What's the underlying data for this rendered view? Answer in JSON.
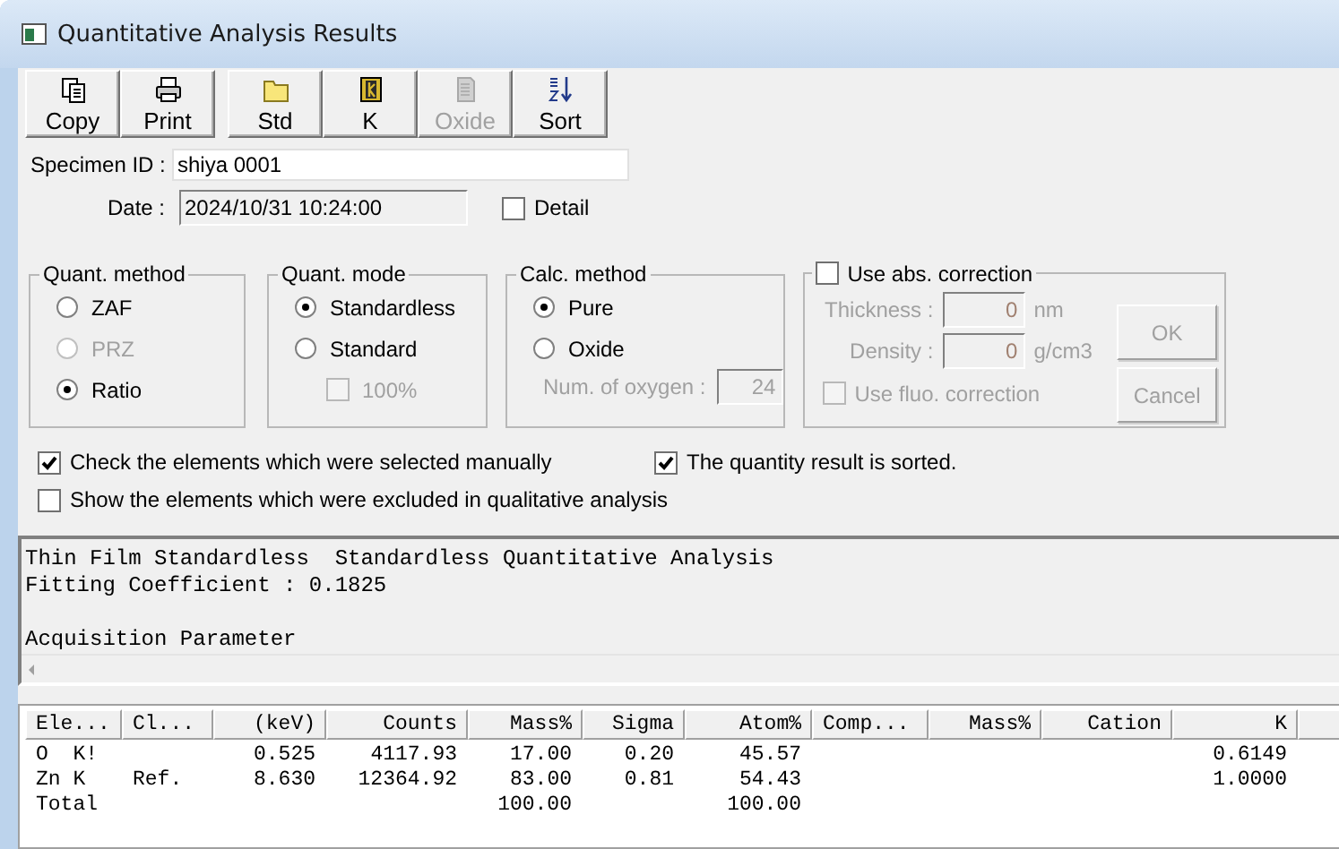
{
  "window": {
    "title": "Quantitative Analysis Results"
  },
  "toolbar": [
    {
      "label": "Copy",
      "kind": "copy",
      "disabled": false
    },
    {
      "label": "Print",
      "kind": "print",
      "disabled": false
    },
    {
      "label": "Std",
      "kind": "folder",
      "disabled": false
    },
    {
      "label": "K",
      "kind": "book",
      "disabled": false
    },
    {
      "label": "Oxide",
      "kind": "document",
      "disabled": true
    },
    {
      "label": "Sort",
      "kind": "sort",
      "disabled": false
    }
  ],
  "specimen_id": {
    "label": "Specimen ID :",
    "value": "shiya 0001"
  },
  "date": {
    "label": "Date :",
    "value": "2024/10/31 10:24:00"
  },
  "detail": {
    "label": "Detail",
    "checked": false
  },
  "quant_method": {
    "title": "Quant. method",
    "options": [
      {
        "label": "ZAF",
        "selected": false,
        "disabled": false
      },
      {
        "label": "PRZ",
        "selected": false,
        "disabled": true
      },
      {
        "label": "Ratio",
        "selected": true,
        "disabled": false
      }
    ]
  },
  "quant_mode": {
    "title": "Quant. mode",
    "options": [
      {
        "label": "Standardless",
        "selected": true,
        "disabled": false
      },
      {
        "label": "Standard",
        "selected": false,
        "disabled": false
      }
    ],
    "hundred_percent": {
      "label": "100%",
      "checked": false,
      "disabled": true
    }
  },
  "calc_method": {
    "title": "Calc. method",
    "options": [
      {
        "label": "Pure",
        "selected": true,
        "disabled": false
      },
      {
        "label": "Oxide",
        "selected": false,
        "disabled": false
      }
    ],
    "num_oxygen": {
      "label": "Num. of oxygen :",
      "value": "24",
      "disabled": true
    }
  },
  "abs_correction": {
    "label": "Use abs. correction",
    "checked": false,
    "fields": [
      {
        "label": "Thickness :",
        "value": "0",
        "unit": "nm",
        "disabled": true
      },
      {
        "label": "Density :",
        "value": "0",
        "unit": "g/cm3",
        "disabled": true
      }
    ],
    "fluo": {
      "label": "Use fluo. correction",
      "checked": false,
      "disabled": true
    },
    "buttons": [
      {
        "label": "OK",
        "disabled": true
      },
      {
        "label": "Cancel",
        "disabled": true
      }
    ]
  },
  "options": [
    {
      "label": "Check the elements which were selected manually",
      "checked": true
    },
    {
      "label": "The quantity result is sorted.",
      "checked": true
    },
    {
      "label": "Show the elements which were excluded in qualitative analysis",
      "checked": false
    }
  ],
  "report": {
    "lines": [
      "Thin Film Standardless  Standardless Quantitative Analysis",
      "Fitting Coefficient : 0.1825"
    ],
    "section_heading": "Acquisition Parameter"
  },
  "table": {
    "columns": [
      "Ele...",
      "Cl...",
      "(keV)",
      "Counts",
      "Mass%",
      "Sigma",
      "Atom%",
      "Comp...",
      "Mass%",
      "Cation",
      "K"
    ],
    "rows": [
      [
        "O  K!",
        null,
        "0.525",
        "4117.93",
        "17.00",
        "0.20",
        "45.57",
        null,
        null,
        null,
        "0.6149"
      ],
      [
        "Zn K",
        "Ref.",
        "8.630",
        "12364.92",
        "83.00",
        "0.81",
        "54.43",
        null,
        null,
        null,
        "1.0000"
      ],
      [
        "Total",
        null,
        null,
        null,
        "100.00",
        null,
        "100.00",
        null,
        null,
        null,
        null
      ]
    ]
  }
}
